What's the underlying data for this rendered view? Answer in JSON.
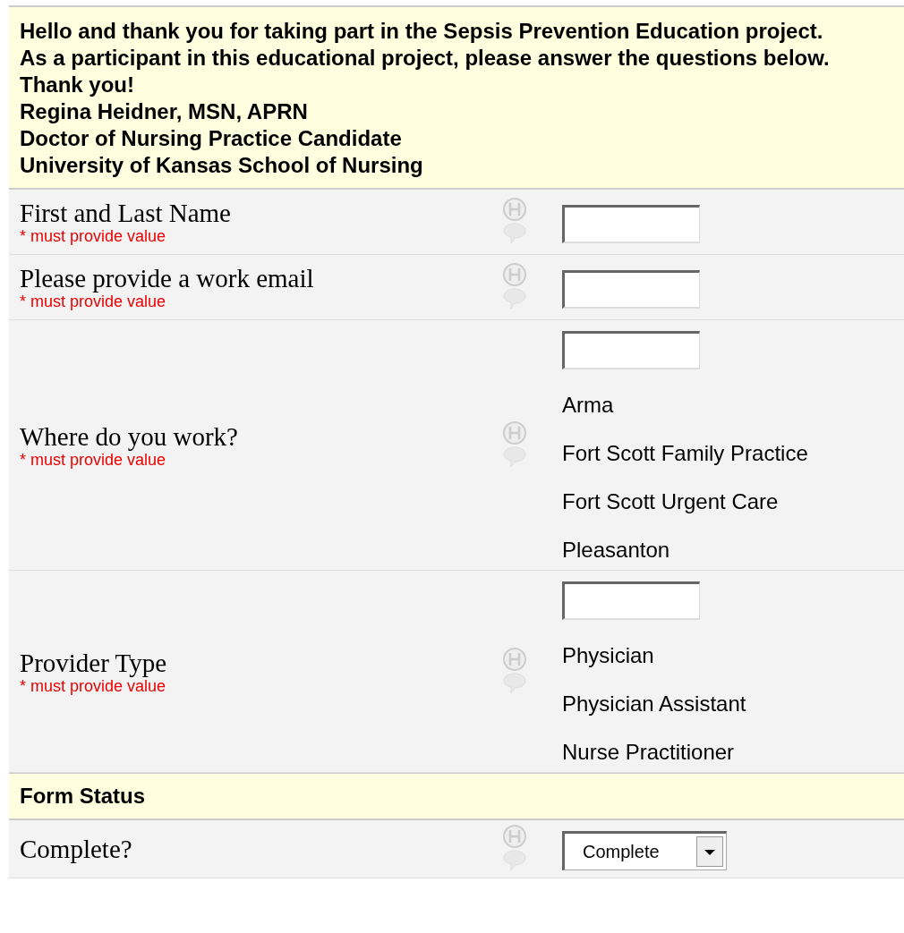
{
  "intro": [
    "Hello and thank you for taking part in the Sepsis Prevention Education project.",
    "As a participant in this educational project, please answer the questions below.",
    "Thank you!",
    "Regina Heidner, MSN, APRN",
    "Doctor of Nursing Practice Candidate",
    "University of Kansas School of Nursing"
  ],
  "rows": [
    {
      "kind": "text",
      "label": "First and Last Name",
      "note": "* must provide value"
    },
    {
      "kind": "text",
      "label": "Please provide a work email",
      "note": "* must provide value"
    },
    {
      "kind": "radio",
      "label": "Where do you work?",
      "note": "* must provide value",
      "options": [
        "Arma",
        "Fort Scott Family Practice",
        "Fort Scott Urgent Care",
        "Pleasanton"
      ]
    },
    {
      "kind": "radio",
      "label": "Provider Type",
      "note": "* must provide value",
      "options": [
        "Physician",
        "Physician Assistant",
        "Nurse Practitioner"
      ]
    },
    {
      "kind": "section",
      "label": "Form Status"
    },
    {
      "kind": "select",
      "label": "Complete?",
      "value": "Complete"
    }
  ]
}
